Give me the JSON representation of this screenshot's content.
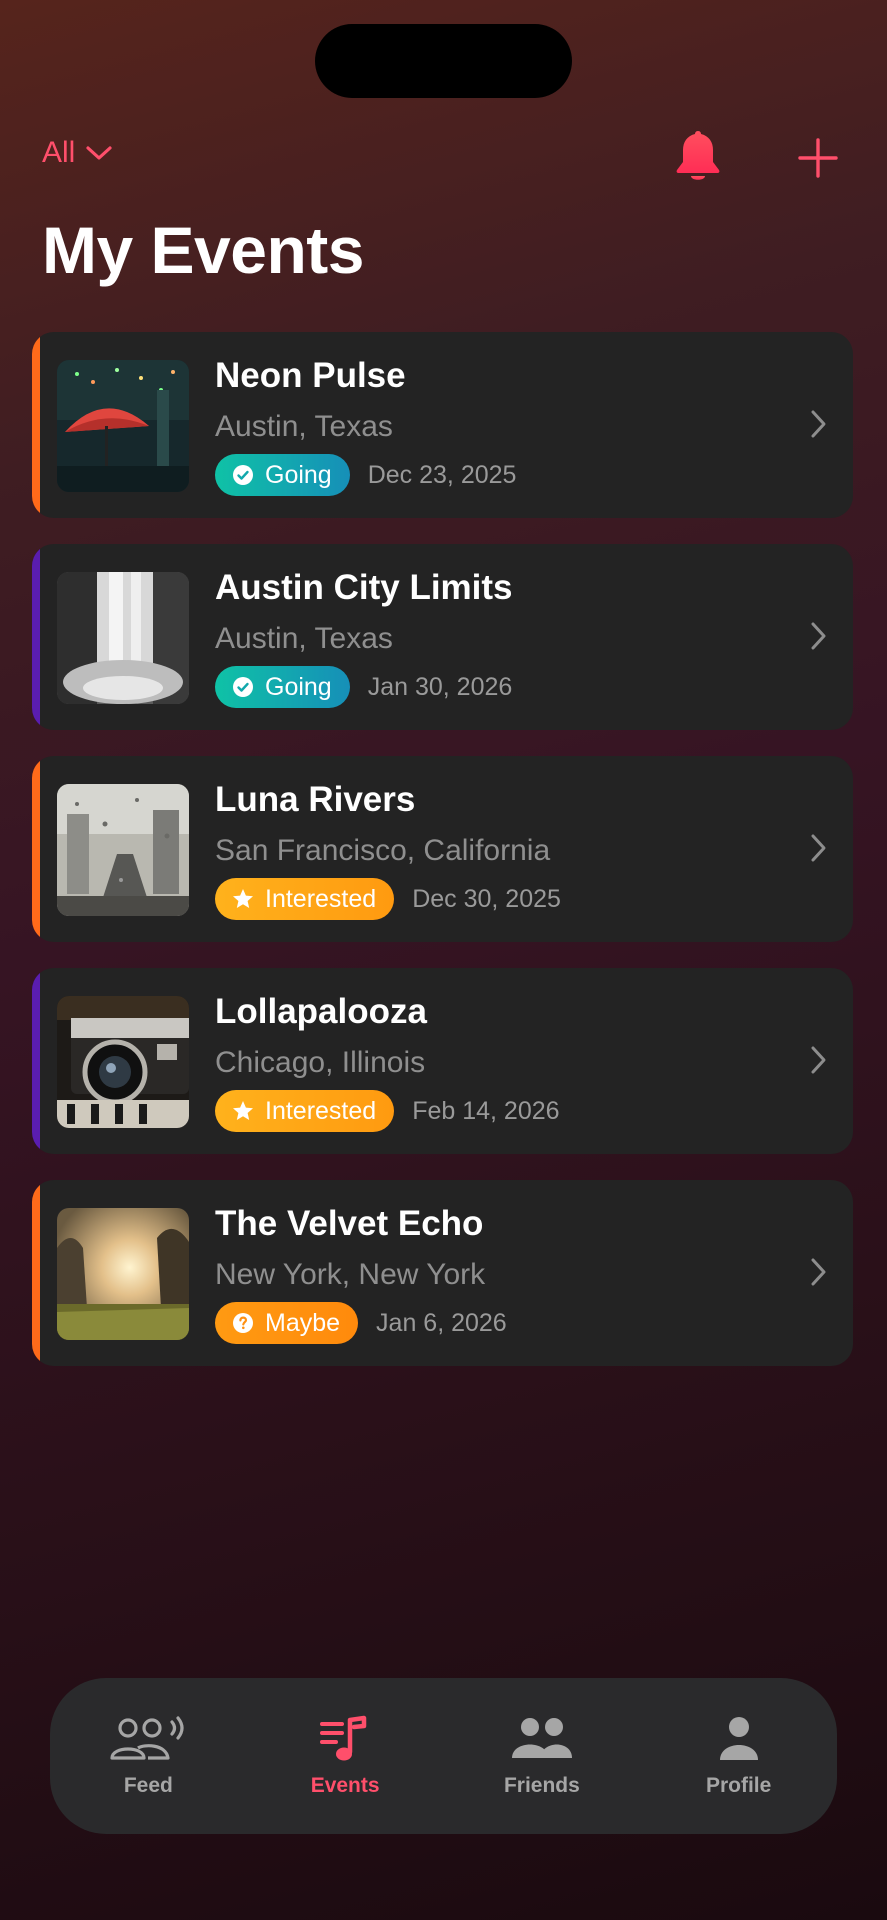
{
  "header": {
    "filter_label": "All",
    "title": "My Events"
  },
  "colors": {
    "accent": "#ff4f6b",
    "going": "#0fb3a8",
    "interested": "#ffa41b",
    "maybe": "#ff9812",
    "stripe_orange": "#ff6a1a",
    "stripe_purple": "#5a1db0"
  },
  "events": [
    {
      "name": "Neon Pulse",
      "location": "Austin, Texas",
      "status": "Going",
      "status_icon": "check-circle-icon",
      "date": "Dec 23, 2025",
      "stripe": "orange"
    },
    {
      "name": "Austin City Limits",
      "location": "Austin, Texas",
      "status": "Going",
      "status_icon": "check-circle-icon",
      "date": "Jan 30, 2026",
      "stripe": "purple"
    },
    {
      "name": "Luna Rivers",
      "location": "San Francisco, California",
      "status": "Interested",
      "status_icon": "star-icon",
      "date": "Dec 30, 2025",
      "stripe": "orange"
    },
    {
      "name": "Lollapalooza",
      "location": "Chicago, Illinois",
      "status": "Interested",
      "status_icon": "star-icon",
      "date": "Feb 14, 2026",
      "stripe": "purple"
    },
    {
      "name": "The Velvet Echo",
      "location": "New York, New York",
      "status": "Maybe",
      "status_icon": "question-circle-icon",
      "date": "Jan 6, 2026",
      "stripe": "orange"
    }
  ],
  "tabbar": {
    "tabs": [
      {
        "label": "Feed",
        "icon": "feed-people-icon"
      },
      {
        "label": "Events",
        "icon": "music-list-icon",
        "active": true
      },
      {
        "label": "Friends",
        "icon": "friends-icon"
      },
      {
        "label": "Profile",
        "icon": "profile-icon"
      }
    ]
  }
}
